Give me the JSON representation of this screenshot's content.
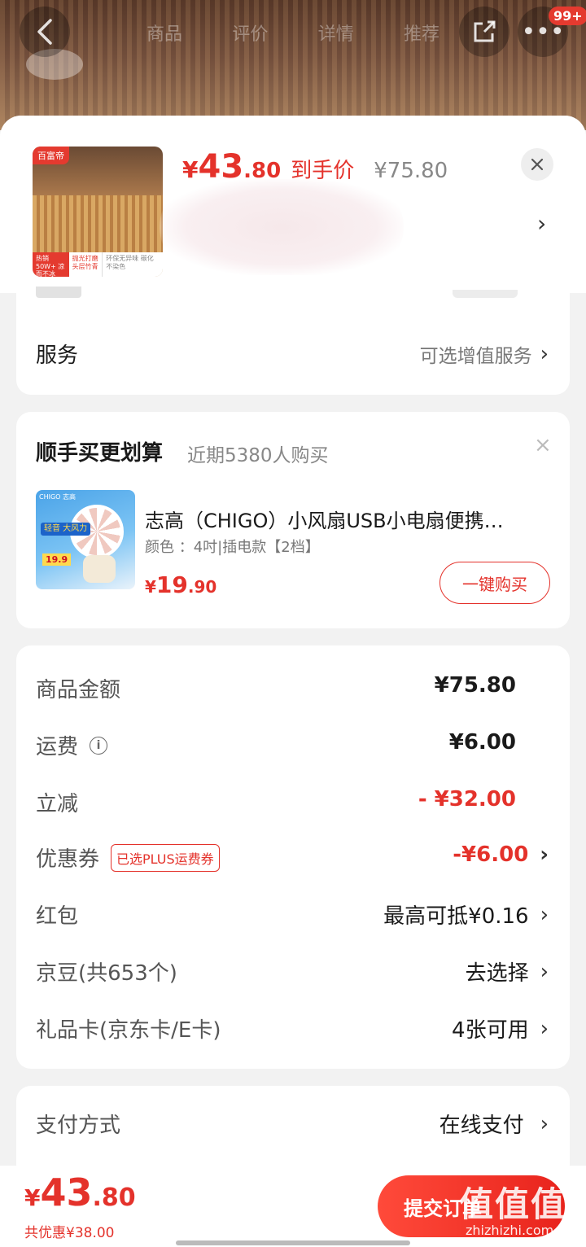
{
  "top_nav": {
    "back_icon": "chevron-left-icon",
    "tabs": [
      "商品",
      "评价",
      "详情",
      "推荐"
    ],
    "share_icon": "share-icon",
    "more_icon": "more-icon",
    "badge": "99+"
  },
  "product": {
    "thumb_badge": "百富帝",
    "thumb_band_1": "热销50W+ 凉而不冰",
    "thumb_band_2": "抛光打磨 头层竹青",
    "thumb_band_3": "环保无异味 碳化不染色",
    "price_symbol": "¥",
    "price_int": "43",
    "price_dec": ".80",
    "price_label": "到手价",
    "original_price": "¥75.80",
    "close_icon": "close-icon",
    "chevron": "›"
  },
  "service": {
    "label": "服务",
    "value": "可选增值服务",
    "chevron": "›"
  },
  "recommend": {
    "title": "顺手买更划算",
    "subtitle": "近期5380人购买",
    "close": "×",
    "thumb_logo": "CHIGO 志高",
    "thumb_tag": "轻音 大风力",
    "thumb_price_tag": "19.9",
    "item_name": "志高（CHIGO）小风扇USB小电扇便携…",
    "item_spec": "颜色 ：4吋|插电款【2档】",
    "price_symbol": "¥",
    "price_int": "19",
    "price_dec": ".90",
    "buy_label": "一键购买"
  },
  "amounts": {
    "goods_label": "商品金额",
    "goods_value": "¥75.80",
    "shipping_label": "运费",
    "shipping_info_icon": "info-icon",
    "shipping_value": "¥6.00",
    "discount_label": "立减",
    "discount_value": "- ¥32.00",
    "coupon_label": "优惠券",
    "coupon_tag": "已选PLUS运费券",
    "coupon_value": "-¥6.00",
    "redpacket_label": "红包",
    "redpacket_value": "最高可抵¥0.16",
    "jingdou_label": "京豆(共653个)",
    "jingdou_value": "去选择",
    "giftcard_label": "礼品卡(京东卡/E卡)",
    "giftcard_value": "4张可用",
    "chevron": "›"
  },
  "payment": {
    "label": "支付方式",
    "value": "在线支付",
    "chevron": "›"
  },
  "bottom": {
    "price_symbol": "¥",
    "price_int": "43",
    "price_dec": ".80",
    "saved": "共优惠¥38.00",
    "submit_label": "提交订单",
    "watermark_logo": "值值值",
    "watermark_text": "zhizhizhi.com"
  },
  "colors": {
    "accent": "#e4322b",
    "background": "#f2f2f2"
  }
}
